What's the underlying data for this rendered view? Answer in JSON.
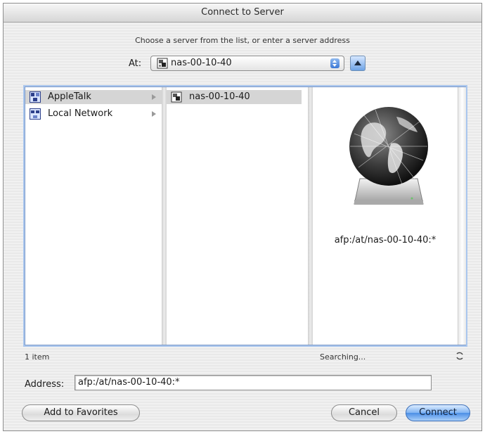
{
  "window": {
    "title": "Connect to Server"
  },
  "instruction": "Choose a server from the list, or enter a server address",
  "at": {
    "label": "At:",
    "value": "nas-00-10-40"
  },
  "browser": {
    "column1": [
      {
        "label": "AppleTalk",
        "icon": "appletalk-icon",
        "selected": true
      },
      {
        "label": "Local Network",
        "icon": "local-network-icon",
        "selected": false
      }
    ],
    "column2": [
      {
        "label": "nas-00-10-40",
        "icon": "server-icon",
        "selected": true
      }
    ],
    "preview": {
      "icon": "network-globe-drive-icon",
      "address": "afp:/at/nas-00-10-40:*"
    }
  },
  "status": {
    "count": "1 item",
    "searching": "Searching..."
  },
  "address": {
    "label": "Address:",
    "value": "afp:/at/nas-00-10-40:*"
  },
  "buttons": {
    "add_favorites": "Add to Favorites",
    "cancel": "Cancel",
    "connect": "Connect"
  },
  "colors": {
    "selection": "#d5d5d5",
    "focus_ring": "#a9c6ee",
    "default_button": "#4b8fe6"
  }
}
